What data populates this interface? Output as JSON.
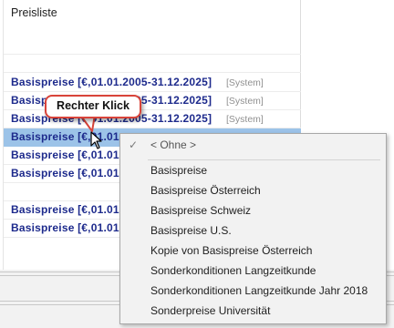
{
  "header": {
    "title": "Preisliste"
  },
  "rows": [
    {
      "name": "Basispreise [€,01.01.2005-31.12.2025]",
      "tag": "[System]"
    },
    {
      "name": "Basispreise [€,01.01.2005-31.12.2025]",
      "tag": "[System]"
    },
    {
      "name": "Basispreise [€,01.01.2005-31.12.2025]",
      "tag": "[System]"
    },
    {
      "name": "Basispreise [€,01.01",
      "tag": ""
    },
    {
      "name": "Basispreise [€,01.01",
      "tag": ""
    },
    {
      "name": "Basispreise [€,01.01",
      "tag": ""
    },
    {
      "name": "Basispreise [€,01.01",
      "tag": ""
    },
    {
      "name": "Basispreise [€,01.01",
      "tag": ""
    }
  ],
  "callout": {
    "text": "Rechter Klick"
  },
  "context_menu": {
    "none_item": "< Ohne >",
    "items": [
      "Basispreise",
      "Basispreise Österreich",
      "Basispreise Schweiz",
      "Basispreise U.S.",
      "Kopie von Basispreise Österreich",
      "Sonderkonditionen Langzeitkunde",
      "Sonderkonditionen Langzeitkunde Jahr 2018",
      "Sonderpreise Universität"
    ]
  },
  "colors": {
    "row_text": "#1d2a8c",
    "selection": "#9cc3e8",
    "callout_border": "#d9443a"
  }
}
